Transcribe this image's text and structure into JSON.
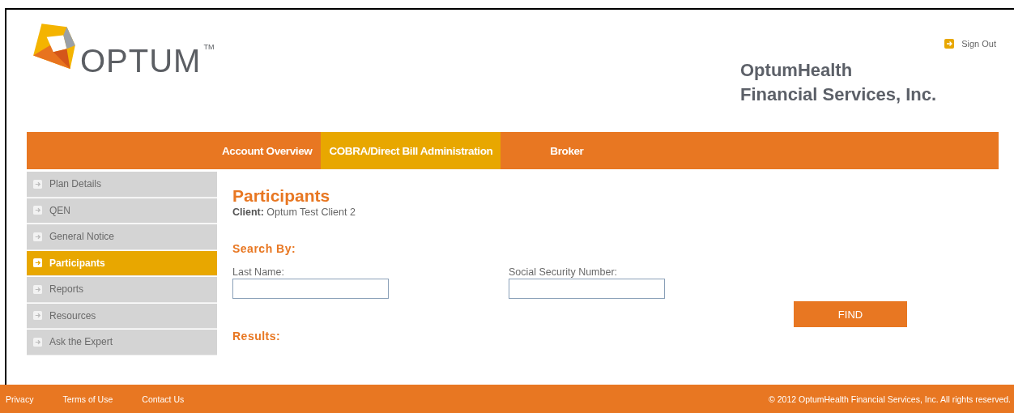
{
  "logo": {
    "wordmark": "OPTUM",
    "trademark": "TM"
  },
  "sign_out": "Sign Out",
  "company": [
    "OptumHealth",
    "Financial Services, Inc."
  ],
  "nav_tabs": [
    {
      "label": "Account Overview",
      "selected": false
    },
    {
      "label": "COBRA/Direct Bill Administration",
      "selected": true
    },
    {
      "label": "Broker",
      "selected": false
    }
  ],
  "sidebar": {
    "items": [
      {
        "label": "Plan Details",
        "selected": false
      },
      {
        "label": "QEN",
        "selected": false
      },
      {
        "label": "General Notice",
        "selected": false
      },
      {
        "label": "Participants",
        "selected": true
      },
      {
        "label": "Reports",
        "selected": false
      },
      {
        "label": "Resources",
        "selected": false
      },
      {
        "label": "Ask the Expert",
        "selected": false
      }
    ]
  },
  "page_title": "Participants",
  "client": {
    "label": "Client:",
    "value": "Optum Test Client 2"
  },
  "search_heading": "Search By:",
  "fields": [
    {
      "label": "Last Name:"
    },
    {
      "label": "Social Security Number:"
    }
  ],
  "find_button": "FIND",
  "results_heading": "Results:",
  "footer": {
    "links": [
      "Privacy",
      "Terms of Use",
      "Contact Us"
    ],
    "copyright": "© 2012 OptumHealth Financial Services, Inc. All rights reserved."
  }
}
